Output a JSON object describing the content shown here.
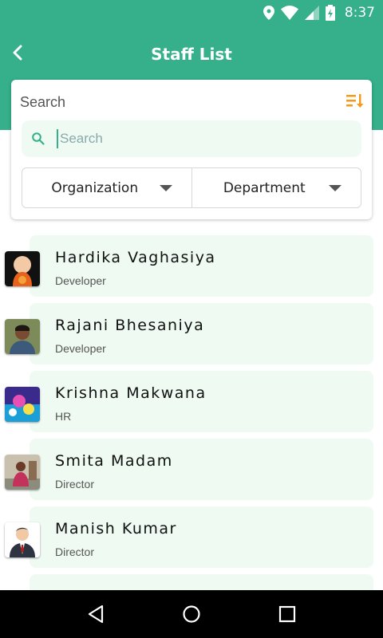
{
  "status_bar": {
    "time": "8:37"
  },
  "app_bar": {
    "title": "Staff List"
  },
  "search_panel": {
    "title": "Search",
    "search_input": {
      "placeholder": "Search",
      "value": ""
    },
    "filters": {
      "organization": "Organization",
      "department": "Department"
    }
  },
  "staff": [
    {
      "name": "Hardika Vaghasiya",
      "role": "Developer"
    },
    {
      "name": "Rajani Bhesaniya",
      "role": "Developer"
    },
    {
      "name": "Krishna Makwana",
      "role": "HR"
    },
    {
      "name": "Smita Madam",
      "role": "Director"
    },
    {
      "name": "Manish Kumar",
      "role": "Director"
    }
  ],
  "colors": {
    "primary": "#35b08b",
    "row_bg": "#effaf3",
    "accent": "#f39a1b"
  },
  "icons": [
    "location-icon",
    "wifi-icon",
    "signal-icon",
    "battery-icon",
    "back-arrow-icon",
    "sort-icon",
    "search-icon",
    "dropdown-caret-icon",
    "nav-back-icon",
    "nav-home-icon",
    "nav-recents-icon"
  ]
}
